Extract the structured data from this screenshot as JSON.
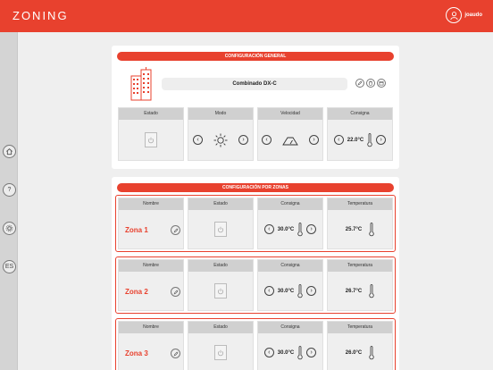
{
  "app": {
    "logo": "ZONING",
    "user": "joaudo"
  },
  "sidebar": [
    {
      "name": "home-icon",
      "label": ""
    },
    {
      "name": "help-icon",
      "label": "?"
    },
    {
      "name": "settings-icon",
      "label": ""
    },
    {
      "name": "language-button",
      "label": "ES"
    }
  ],
  "general": {
    "title": "CONFIGURACIÓN GENERAL",
    "device": "Combinado DX-C",
    "estado_label": "Estado",
    "modo_label": "Modo",
    "velocidad_label": "Velocidad",
    "consigna_label": "Consigna",
    "consigna_value": "22.0°C"
  },
  "zones": {
    "title": "CONFIGURACIÓN POR ZONAS",
    "headers": {
      "nombre": "Nombre",
      "estado": "Estado",
      "consigna": "Consigna",
      "temperatura": "Temperatura"
    },
    "items": [
      {
        "name": "Zona 1",
        "consigna": "30.0°C",
        "temperatura": "25.7°C"
      },
      {
        "name": "Zona 2",
        "consigna": "30.0°C",
        "temperatura": "26.7°C"
      },
      {
        "name": "Zona 3",
        "consigna": "30.0°C",
        "temperatura": "26.0°C"
      }
    ]
  },
  "colors": {
    "accent": "#e8412e",
    "background": "#efefef",
    "cell_header": "#d0d0d0"
  }
}
